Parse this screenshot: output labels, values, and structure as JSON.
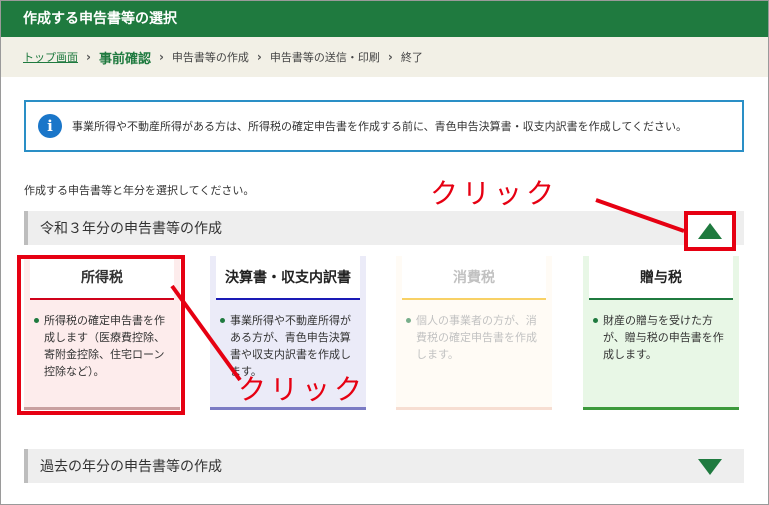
{
  "header": {
    "title": "作成する申告書等の選択"
  },
  "breadcrumb": {
    "items": [
      {
        "label": "トップ画面"
      },
      {
        "label": "事前確認"
      },
      {
        "label": "申告書等の作成"
      },
      {
        "label": "申告書等の送信・印刷"
      },
      {
        "label": "終了"
      }
    ]
  },
  "notice": {
    "icon": "info-icon",
    "text": "事業所得や不動産所得がある方は、所得税の確定申告書を作成する前に、青色申告決算書・収支内訳書を作成してください。"
  },
  "instruction": "作成する申告書等と年分を選択してください。",
  "current_section": {
    "title": "令和３年分の申告書等の作成",
    "toggle_icon": "triangle-up-icon"
  },
  "cards": [
    {
      "title": "所得税",
      "desc": "所得税の確定申告書を作成します（医療費控除、寄附金控除、住宅ローン控除など）。"
    },
    {
      "title": "決算書・収支内訳書",
      "desc": "事業所得や不動産所得がある方が、青色申告決算書や収支内訳書を作成します。"
    },
    {
      "title": "消費税",
      "desc": "個人の事業者の方が、消費税の確定申告書を作成します。"
    },
    {
      "title": "贈与税",
      "desc": "財産の贈与を受けた方が、贈与税の申告書を作成します。"
    }
  ],
  "past_section": {
    "title": "過去の年分の申告書等の作成",
    "toggle_icon": "triangle-down-icon"
  },
  "annotations": {
    "click_top": "クリック",
    "click_bottom": "クリック"
  },
  "colors": {
    "brand_green": "#1f7a3f",
    "annotation_red": "#e60012",
    "info_blue": "#1a76c9"
  }
}
